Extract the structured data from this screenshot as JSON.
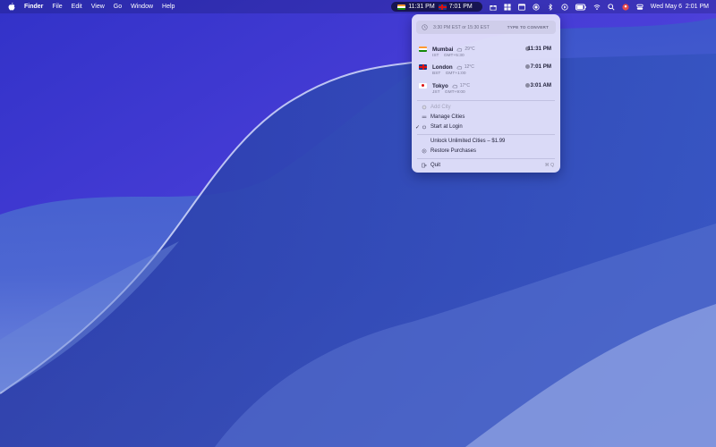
{
  "menubar": {
    "app": "Finder",
    "menus": [
      "File",
      "Edit",
      "View",
      "Go",
      "Window",
      "Help"
    ],
    "ticker": [
      {
        "flag": "india",
        "time": "11:31 PM"
      },
      {
        "flag": "uk",
        "time": "7:01 PM"
      }
    ],
    "status_icons": [
      "gift-icon",
      "grid-icon",
      "window-icon",
      "record-icon",
      "bluetooth-icon",
      "play-circle-icon",
      "battery-icon",
      "wifi-icon",
      "search-icon",
      "user-icon",
      "control-center-icon"
    ],
    "datetime": "Wed May 6  2:01 PM"
  },
  "dropdown": {
    "search_text": "3:30 PM EST or 15:30 EST",
    "search_hint": "TYPE TO CONVERT",
    "cities": [
      {
        "name": "Mumbai",
        "flag": "india",
        "weather": "29°C",
        "time": "11:31 PM",
        "zone": "IST",
        "offset": "GMT+5:30"
      },
      {
        "name": "London",
        "flag": "uk",
        "weather": "12°C",
        "time": "7:01 PM",
        "zone": "BST",
        "offset": "GMT+1:00"
      },
      {
        "name": "Tokyo",
        "flag": "japan",
        "weather": "17°C",
        "time": "3:01 AM",
        "zone": "JST",
        "offset": "GMT+9:00"
      }
    ],
    "add_city": "Add City",
    "manage_cities": "Manage Cities",
    "start_at_login": "Start at Login",
    "start_at_login_checked": true,
    "unlock": "Unlock Unlimited Cities – $1.99",
    "restore": "Restore Purchases",
    "quit": "Quit",
    "quit_shortcut": "⌘ Q"
  }
}
